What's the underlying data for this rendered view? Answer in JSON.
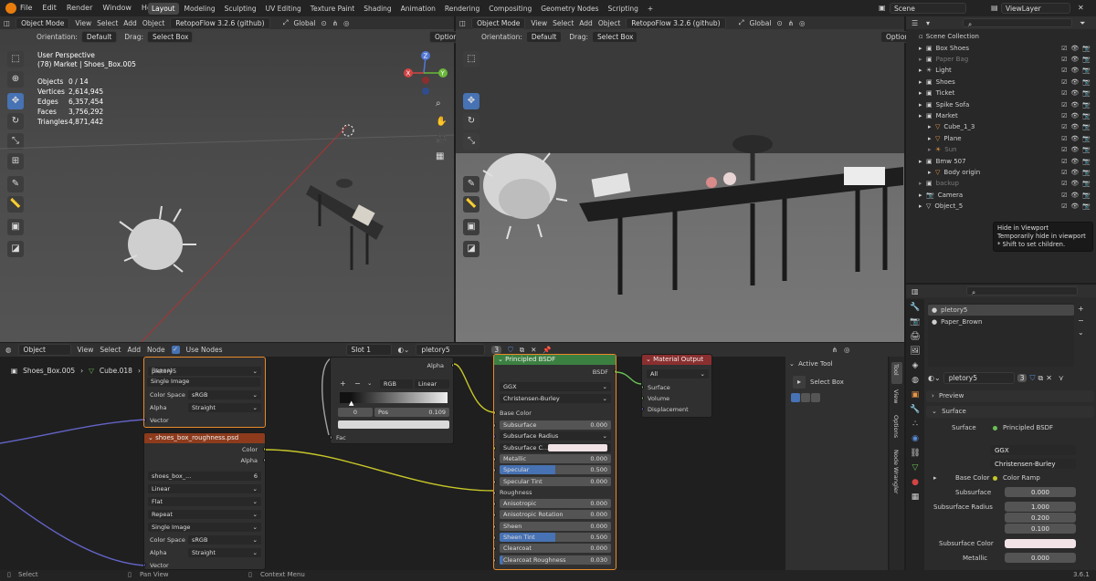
{
  "topbar": {
    "menus": [
      "File",
      "Edit",
      "Render",
      "Window",
      "Help"
    ],
    "workspaces": [
      "Layout",
      "Modeling",
      "Sculpting",
      "UV Editing",
      "Texture Paint",
      "Shading",
      "Animation",
      "Rendering",
      "Compositing",
      "Geometry Nodes",
      "Scripting"
    ],
    "active_workspace": "Layout",
    "scene": "Scene",
    "view_layer": "ViewLayer"
  },
  "vp_left": {
    "mode": "Object Mode",
    "menus": [
      "View",
      "Select",
      "Add",
      "Object"
    ],
    "addon": "RetopoFlow 3.2.6 (github)",
    "transform": "Global",
    "orientation_label": "Orientation:",
    "orientation": "Default",
    "drag_label": "Drag:",
    "drag": "Select Box",
    "options": "Options",
    "overlay_title": "User Perspective",
    "overlay_sub": "(78) Market | Shoes_Box.005",
    "stats": [
      {
        "k": "Objects",
        "v": "0 / 14"
      },
      {
        "k": "Vertices",
        "v": "2,614,945"
      },
      {
        "k": "Edges",
        "v": "6,357,454"
      },
      {
        "k": "Faces",
        "v": "3,756,292"
      },
      {
        "k": "Triangles",
        "v": "4,871,442"
      }
    ],
    "gizmo": {
      "z": "Z",
      "y": "Y",
      "x": "X"
    }
  },
  "vp_right": {
    "mode": "Object Mode",
    "menus": [
      "View",
      "Select",
      "Add",
      "Object"
    ],
    "addon": "RetopoFlow 3.2.6 (github)",
    "transform": "Global",
    "orientation_label": "Orientation:",
    "orientation": "Default",
    "drag_label": "Drag:",
    "drag": "Select Box",
    "options": "Options"
  },
  "outliner": {
    "root": "Scene Collection",
    "items": [
      {
        "label": "Box Shoes",
        "indent": 0
      },
      {
        "label": "Paper Bag",
        "indent": 0,
        "dim": true
      },
      {
        "label": "Light",
        "indent": 0
      },
      {
        "label": "Shoes",
        "indent": 0
      },
      {
        "label": "Ticket",
        "indent": 0
      },
      {
        "label": "Spike Sofa",
        "indent": 0
      },
      {
        "label": "Market",
        "indent": 0
      },
      {
        "label": "Cube_1_3",
        "indent": 1
      },
      {
        "label": "Plane",
        "indent": 1
      },
      {
        "label": "Sun",
        "indent": 1,
        "dim": true
      },
      {
        "label": "Bmw 507",
        "indent": 0
      },
      {
        "label": "Body origin",
        "indent": 1
      },
      {
        "label": "backup",
        "indent": 0,
        "dim": true
      },
      {
        "label": "Camera",
        "indent": 0
      },
      {
        "label": "Object_5",
        "indent": 0
      }
    ],
    "tooltip": {
      "title": "Hide in Viewport",
      "line1": "Temporarily hide in viewport",
      "line2": "* Shift to set children."
    }
  },
  "node_editor": {
    "editor": "Object",
    "menus": [
      "View",
      "Select",
      "Add",
      "Node"
    ],
    "use_nodes": "Use Nodes",
    "slot": "Slot 1",
    "material": "pletory5",
    "users": "3",
    "breadcrumb": [
      "Shoes_Box.005",
      "Cube.018",
      "pletory5"
    ],
    "img1": {
      "title": "Repeat",
      "image": "pletory5",
      "fields": [
        {
          "l": "Color Space",
          "v": "sRGB"
        },
        {
          "l": "Alpha",
          "v": "Straight"
        }
      ],
      "vector": "Vector"
    },
    "img2": {
      "title": "shoes_box_roughness.psd",
      "out_color": "Color",
      "out_alpha": "Alpha",
      "image": "shoes_box_...",
      "users": "6",
      "opts": [
        "Linear",
        "Flat",
        "Repeat",
        "Single Image"
      ],
      "fields": [
        {
          "l": "Color Space",
          "v": "sRGB"
        },
        {
          "l": "Alpha",
          "v": "Straight"
        }
      ],
      "vector": "Vector"
    },
    "ramp": {
      "alpha": "Alpha",
      "mode": "RGB",
      "interp": "Linear",
      "index": "0",
      "pos_label": "Pos",
      "pos": "0.109",
      "fac": "Fac",
      "plus": "+",
      "minus": "−"
    },
    "bsdf": {
      "title": "Principled BSDF",
      "out": "BSDF",
      "dist": "GGX",
      "sss": "Christensen-Burley",
      "base": "Base Color",
      "rows": [
        {
          "l": "Subsurface",
          "v": "0.000"
        },
        {
          "l": "Subsurface Radius",
          "v": ""
        },
        {
          "l": "Subsurface C...",
          "v": ""
        },
        {
          "l": "Metallic",
          "v": "0.000"
        },
        {
          "l": "Specular",
          "v": "0.500",
          "fill": 0.5
        },
        {
          "l": "Specular Tint",
          "v": "0.000"
        },
        {
          "l": "Roughness",
          "v": ""
        },
        {
          "l": "Anisotropic",
          "v": "0.000"
        },
        {
          "l": "Anisotropic Rotation",
          "v": "0.000"
        },
        {
          "l": "Sheen",
          "v": "0.000"
        },
        {
          "l": "Sheen Tint",
          "v": "0.500",
          "fill": 0.5
        },
        {
          "l": "Clearcoat",
          "v": "0.000"
        },
        {
          "l": "Clearcoat Roughness",
          "v": "0.030",
          "fill": 0.03
        }
      ]
    },
    "output": {
      "title": "Material Output",
      "target": "All",
      "inputs": [
        "Surface",
        "Volume",
        "Displacement"
      ]
    }
  },
  "sidebar": {
    "tabs": [
      "Tool",
      "View",
      "Options",
      "Node Wrangler"
    ],
    "active_tool": "Active Tool",
    "tool": "Select Box"
  },
  "props": {
    "materials": [
      "pletory5",
      "Paper_Brown"
    ],
    "material": "pletory5",
    "users": "3",
    "preview": "Preview",
    "surface": "Surface",
    "surface_label": "Surface",
    "surface_val": "Principled BSDF",
    "dist": "GGX",
    "sss": "Christensen-Burley",
    "base_label": "Base Color",
    "base_val": "Color Ramp",
    "subsurface_label": "Subsurface",
    "subsurface_val": "0.000",
    "radius_label": "Subsurface Radius",
    "radius": [
      "1.000",
      "0.200",
      "0.100"
    ],
    "sss_color": "Subsurface Color",
    "metallic_label": "Metallic",
    "metallic_val": "0.000"
  },
  "status": {
    "select": "Select",
    "pan": "Pan View",
    "context": "Context Menu",
    "version": "3.6.1"
  },
  "colors": {
    "accent": "#4772b3",
    "node_image": "#8d3b1c",
    "node_shader": "#3c8041",
    "node_output": "#8a2f2f"
  }
}
